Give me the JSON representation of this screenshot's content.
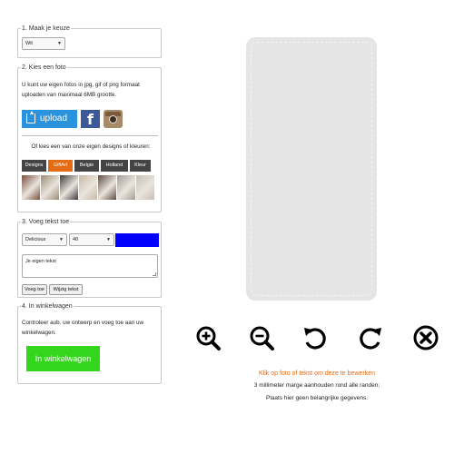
{
  "step1": {
    "legend": "1. Maak je keuze",
    "color_select": "Wit"
  },
  "step2": {
    "legend": "2. Kies een foto",
    "description": "U kunt uw eigen fotos in jpg, gif of png formaat uploaden van maximaal 6MB grootte.",
    "upload_label": "upload",
    "facebook_glyph": "f",
    "designs_prompt": "Of kies een van onze eigen designs of kleuren:",
    "tabs": [
      "Designs",
      "GiftArt",
      "Belgie",
      "Holland",
      "Kleur"
    ],
    "active_tab": "GiftArt",
    "thumbnail_colors": [
      "#7a4f3d",
      "#9b8a75",
      "#3d3a37",
      "#c9b9a3",
      "#5e4a40",
      "#a69d95",
      "#c7bdb6"
    ]
  },
  "step3": {
    "legend": "3. Voeg tekst toe",
    "font_select": "Delicious",
    "size_select": "40",
    "text_color": "#0000ff",
    "text_placeholder": "Je eigen tekst",
    "add_button": "Voeg toe",
    "edit_button": "Wijzig tekst"
  },
  "step4": {
    "legend": "4. In winkelwagen",
    "description": "Controleer aub. uw ontwerp en voeg toe aan uw winkelwagen.",
    "cart_button": "In winkelwagen"
  },
  "toolbar": {
    "icons": [
      "zoom-in-icon",
      "zoom-out-icon",
      "rotate-left-icon",
      "rotate-right-icon",
      "delete-icon"
    ]
  },
  "hints": {
    "edit_hint": "Klik op foto of tekst om deze te bewerken",
    "margin_hint": "3 millimeter marge aanhouden rond alle randen;",
    "info_hint": "Plaats hier geen belangrijke gegevens."
  },
  "colors": {
    "accent_orange": "#e36b14",
    "facebook_blue": "#3b5998",
    "upload_blue": "#2b93dd",
    "cart_green": "#33d51d",
    "phone_case": "#e5e5e5"
  }
}
